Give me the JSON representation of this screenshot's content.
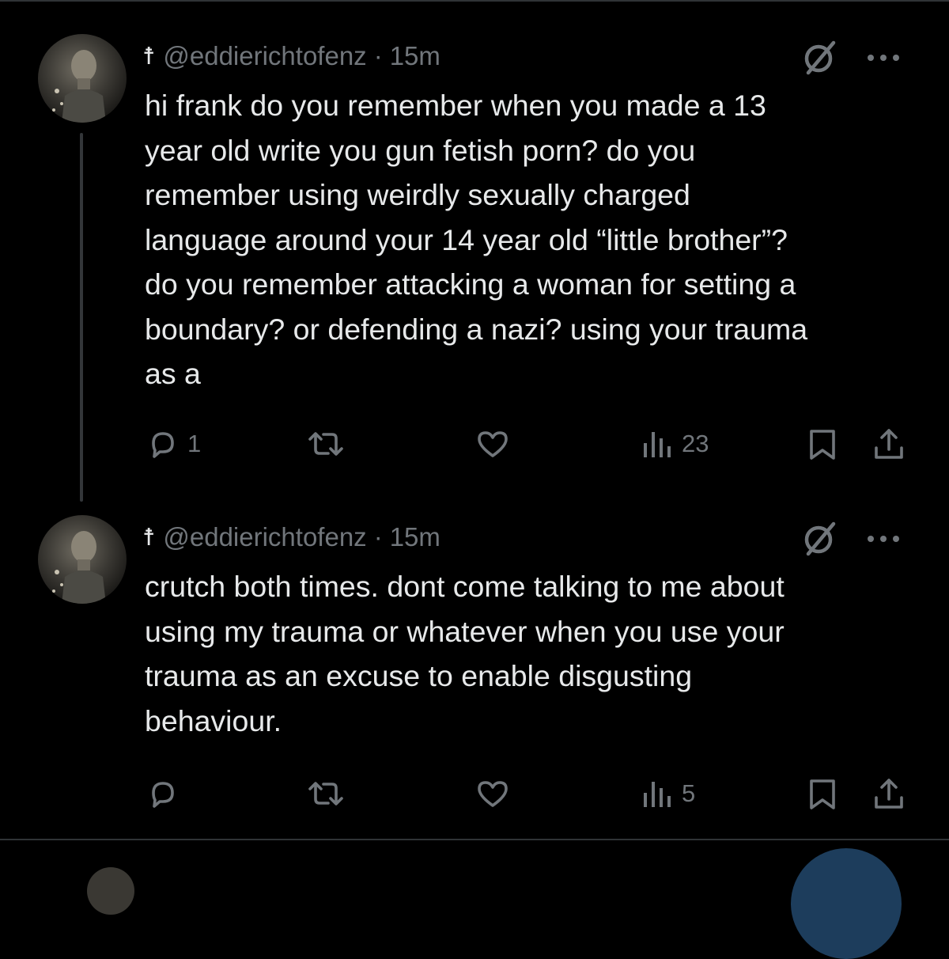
{
  "tweets": [
    {
      "symbol": "☨",
      "handle": "@eddierichtofenz",
      "separator": "·",
      "time": "15m",
      "text": "hi frank do you remember when you made a 13\nyear old write you gun fetish porn? do you\nremember using weirdly sexually charged\nlanguage around your 14 year old “little brother”?\ndo you remember attacking a woman for setting a\nboundary? or defending a nazi? using your trauma\nas a",
      "reply_count": "1",
      "views_count": "23",
      "icons": [
        "blocked-icon",
        "more-icon",
        "reply-icon",
        "retweet-icon",
        "like-icon",
        "views-icon",
        "bookmark-icon",
        "share-icon"
      ]
    },
    {
      "symbol": "☨",
      "handle": "@eddierichtofenz",
      "separator": "·",
      "time": "15m",
      "text": "crutch both times. dont come talking to me about\nusing my trauma or whatever when you use your\ntrauma as an excuse to enable disgusting\nbehaviour.",
      "reply_count": "",
      "views_count": "5",
      "icons": [
        "blocked-icon",
        "more-icon",
        "reply-icon",
        "retweet-icon",
        "like-icon",
        "views-icon",
        "bookmark-icon",
        "share-icon"
      ]
    }
  ],
  "colors": {
    "background": "#000000",
    "text_primary": "#e7e9ea",
    "text_secondary": "#71767b",
    "divider": "#2f3336",
    "thread_line": "#333639",
    "fab": "#1d3d5c"
  }
}
